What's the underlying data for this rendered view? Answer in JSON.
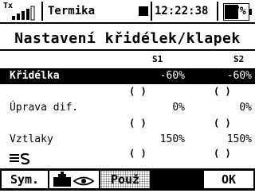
{
  "status": {
    "tx_label": "Tx",
    "signal_level": 4,
    "model_name": "Termika",
    "clock": "12:22:38",
    "battery": "57%"
  },
  "title": "Nastavení křidélek/klapek",
  "columns": {
    "s1": "S1",
    "s2": "S2"
  },
  "rows": [
    {
      "label": "Křidélka",
      "s1": "-60%",
      "s2": "-60%",
      "selected": true
    },
    {
      "label": "Úprava dif.",
      "s1": "0%",
      "s2": "0%",
      "selected": false
    },
    {
      "label": "Vztlaky",
      "s1": "150%",
      "s2": "150%",
      "selected": false
    }
  ],
  "paren_text": "(   )",
  "switch_icon": "switch-s-icon",
  "softkeys": {
    "sym": "Sym.",
    "eye_icon": "servo-view-icon",
    "pouz": "Použ",
    "ok": "OK"
  }
}
